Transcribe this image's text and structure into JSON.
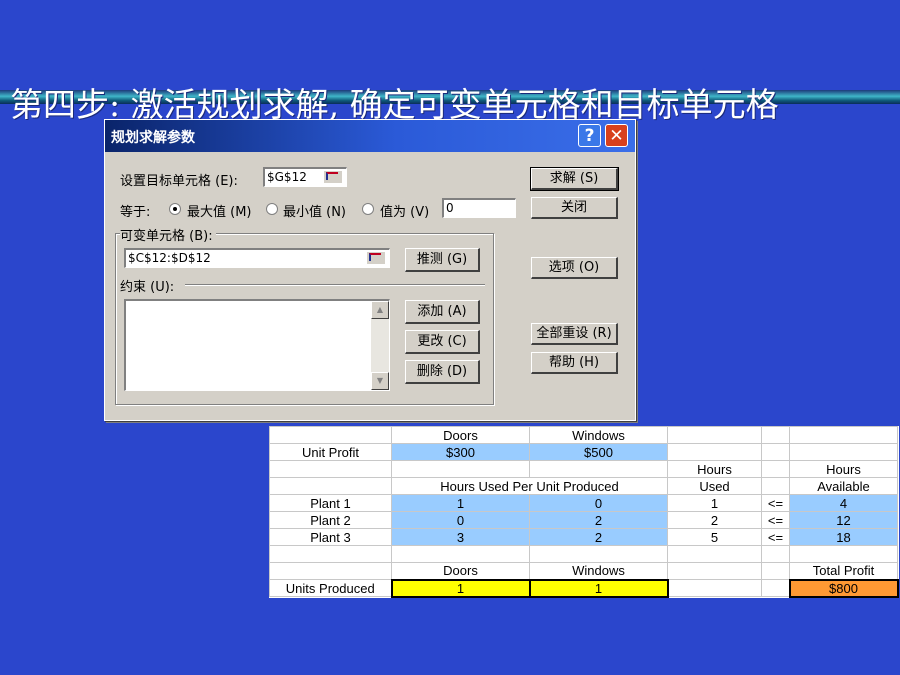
{
  "slide": {
    "title": "第四步: 激活规划求解, 确定可变单元格和目标单元格"
  },
  "dialog": {
    "title": "规划求解参数",
    "help_button": "?",
    "close_button": "✕",
    "target_cell_label": "设置目标单元格 (E):",
    "target_cell_value": "$G$12",
    "equal_to_label": "等于:",
    "radio_max": "最大值 (M)",
    "radio_min": "最小值 (N)",
    "radio_value": "值为 (V)",
    "value_field": "0",
    "changing_cells_label": "可变单元格 (B):",
    "changing_cells_value": "$C$12:$D$12",
    "guess_button": "推测 (G)",
    "constraints_label": "约束 (U):",
    "add_button": "添加 (A)",
    "change_button": "更改 (C)",
    "delete_button": "删除 (D)",
    "solve_button": "求解 (S)",
    "close_dialog_button": "关闭",
    "options_button": "选项 (O)",
    "reset_all_button": "全部重设 (R)",
    "help_text_button": "帮助 (H)",
    "selected_radio": "max"
  },
  "sheet": {
    "header_row": [
      "",
      "Doors",
      "Windows",
      "",
      "",
      ""
    ],
    "unit_profit": {
      "label": "Unit Profit",
      "doors": "$300",
      "windows": "$500"
    },
    "hours_header_1": {
      "used": "Hours",
      "available": "Hours"
    },
    "hours_header_2": {
      "mid": "Hours Used Per Unit Produced",
      "used": "Used",
      "available": "Available"
    },
    "plants": [
      {
        "name": "Plant 1",
        "doors": "1",
        "windows": "0",
        "used": "1",
        "op": "<=",
        "available": "4"
      },
      {
        "name": "Plant 2",
        "doors": "0",
        "windows": "2",
        "used": "2",
        "op": "<=",
        "available": "12"
      },
      {
        "name": "Plant 3",
        "doors": "3",
        "windows": "2",
        "used": "5",
        "op": "<=",
        "available": "18"
      }
    ],
    "output_header": {
      "doors": "Doors",
      "windows": "Windows",
      "total": "Total Profit"
    },
    "units_produced": {
      "label": "Units Produced",
      "doors": "1",
      "windows": "1",
      "total": "$800"
    }
  },
  "colors": {
    "background": "#2b46cc",
    "cell_blue": "#99ccff",
    "cell_yellow": "#ffff00",
    "cell_orange": "#ff9933"
  }
}
